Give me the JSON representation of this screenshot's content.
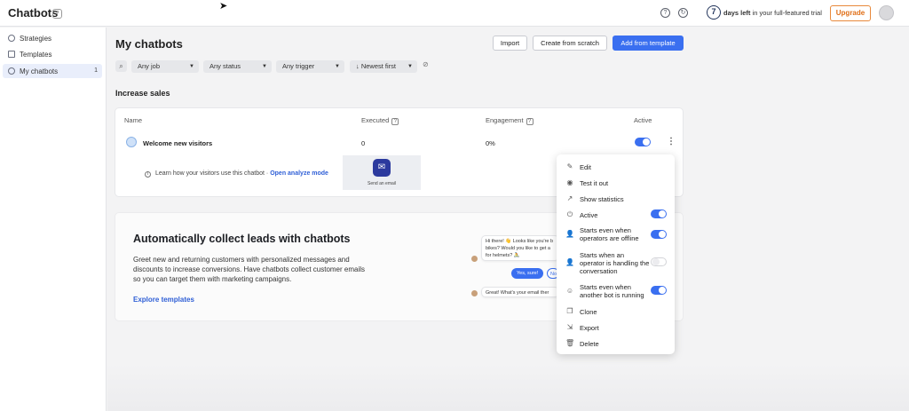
{
  "header": {
    "title": "Chatbots",
    "help_icon": "?",
    "trial_days": "7",
    "trial_bold": "days left",
    "trial_rest": " in your full-featured trial",
    "upgrade_label": "Upgrade"
  },
  "sidebar": {
    "items": [
      {
        "label": "Strategies",
        "count": ""
      },
      {
        "label": "Templates",
        "count": ""
      },
      {
        "label": "My chatbots",
        "count": "1"
      }
    ]
  },
  "main": {
    "title": "My chatbots",
    "buttons": {
      "import": "Import",
      "scratch": "Create from scratch",
      "template": "Add from template"
    },
    "filters": {
      "job": "Any job",
      "status": "Any status",
      "trigger": "Any trigger",
      "sort": "Newest first"
    },
    "section_title": "Increase sales"
  },
  "table": {
    "headers": {
      "name": "Name",
      "executed": "Executed",
      "engagement": "Engagement",
      "active": "Active"
    },
    "row": {
      "name": "Welcome new visitors",
      "executed": "0",
      "engagement": "0%",
      "active": true
    },
    "analyze_text": "Learn how your visitors use this chatbot",
    "analyze_sep": "·",
    "analyze_link": "Open analyze mode",
    "preview_label": "Send an email"
  },
  "promo": {
    "title": "Automatically collect leads with chatbots",
    "text": "Greet new and returning customers with personalized messages and discounts to increase conversions. Have chatbots collect customer emails so you can target them with marketing campaigns.",
    "link": "Explore templates",
    "chat": {
      "bubble1": "Hi there! 👋 Looks like you're b bikes? Would you like to get a for helmets? 🚴",
      "chip_yes": "Yes, sure!",
      "chip_no": "No",
      "bubble2": "Great! What's your email ther"
    }
  },
  "menu": {
    "items": [
      {
        "label": "Edit",
        "icon": "pencil-icon"
      },
      {
        "label": "Test it out",
        "icon": "eye-icon"
      },
      {
        "label": "Show statistics",
        "icon": "chart-icon"
      },
      {
        "label": "Active",
        "icon": "power-icon",
        "toggle": true
      },
      {
        "label": "Starts even when operators are offline",
        "icon": "person-icon",
        "toggle": true
      },
      {
        "label": "Starts when an operator is handling the conversation",
        "icon": "person-icon",
        "toggle": false
      },
      {
        "label": "Starts even when another bot is running",
        "icon": "bot-icon",
        "toggle": true
      },
      {
        "label": "Clone",
        "icon": "copy-icon"
      },
      {
        "label": "Export",
        "icon": "export-icon"
      },
      {
        "label": "Delete",
        "icon": "trash-icon"
      }
    ]
  },
  "colors": {
    "accent": "#3a6ff0",
    "upgrade": "#e06f18",
    "link": "#2f5fd6"
  }
}
